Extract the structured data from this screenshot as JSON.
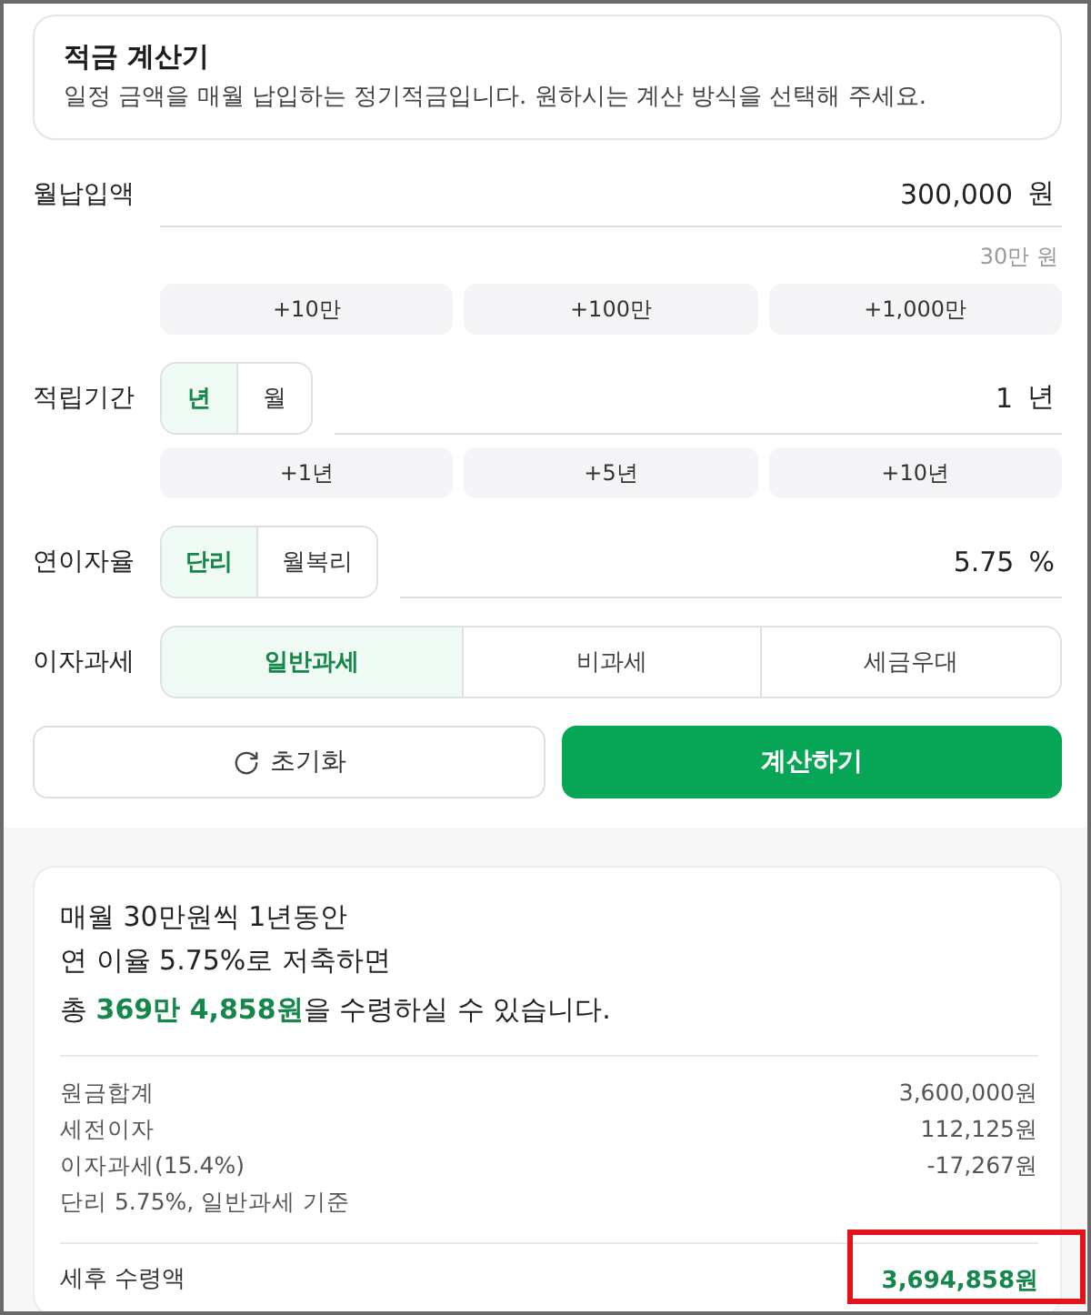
{
  "header": {
    "title": "적금 계산기",
    "description": "일정 금액을 매월 납입하는 정기적금입니다. 원하시는 계산 방식을 선택해 주세요."
  },
  "fields": [
    {
      "kind": "input",
      "label": "월납입액",
      "value": "300,000",
      "unit": "원",
      "hint": "30만 원",
      "quick_buttons": [
        "+10만",
        "+100만",
        "+1,000만"
      ]
    },
    {
      "kind": "input",
      "label": "적립기간",
      "options": [
        {
          "label": "년",
          "selected": true
        },
        {
          "label": "월",
          "selected": false
        }
      ],
      "value": "1",
      "unit": "년",
      "quick_buttons": [
        "+1년",
        "+5년",
        "+10년"
      ]
    },
    {
      "kind": "input",
      "label": "연이자율",
      "options": [
        {
          "label": "단리",
          "selected": true
        },
        {
          "label": "월복리",
          "selected": false
        }
      ],
      "value": "5.75",
      "unit": "%"
    },
    {
      "kind": "segmented",
      "label": "이자과세",
      "options": [
        {
          "label": "일반과세",
          "selected": true
        },
        {
          "label": "비과세",
          "selected": false
        },
        {
          "label": "세금우대",
          "selected": false
        }
      ]
    }
  ],
  "actions": {
    "reset": "초기화",
    "calculate": "계산하기"
  },
  "result": {
    "lines": [
      "매월 30만원씩 1년동안",
      "연 이율 5.75%로 저축하면"
    ],
    "summary": "총 **369만 4,858원**을 수령하실 수 있습니다.",
    "details": [
      {
        "label": "원금합계",
        "value": "3,600,000원"
      },
      {
        "label": "세전이자",
        "value": "112,125원"
      },
      {
        "label": "이자과세(15.4%)",
        "value": "-17,267원"
      },
      {
        "label": "단리 5.75%, 일반과세 기준"
      }
    ],
    "total": {
      "label": "세후 수령액",
      "value": "3,694,858원",
      "highlighted": true
    }
  }
}
